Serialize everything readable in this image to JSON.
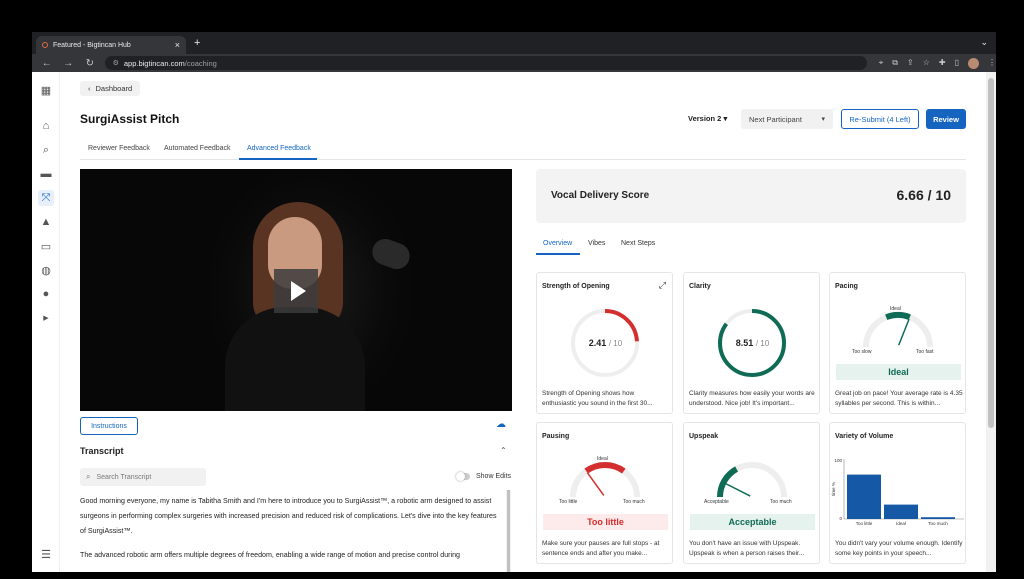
{
  "browser": {
    "tab_title": "Featured - Bigtincan Hub",
    "new_tab": "+",
    "url_host": "app.bigtincan.com",
    "url_path": "/coaching"
  },
  "rail": {
    "icons": [
      "apps-icon",
      "home-icon",
      "search-icon",
      "folder-icon",
      "coaching-icon",
      "graduation-icon",
      "presentation-icon",
      "globe-icon",
      "user-icon",
      "expand-icon"
    ],
    "active_index": 4,
    "bottom_icon": "sliders-icon"
  },
  "header": {
    "breadcrumb": "Dashboard",
    "title": "SurgiAssist Pitch",
    "version": "Version 2",
    "next_participant": "Next Participant",
    "resubmit": "Re-Submit (4 Left)",
    "review": "Review"
  },
  "tabs": [
    "Reviewer Feedback",
    "Automated Feedback",
    "Advanced Feedback"
  ],
  "active_tab": 2,
  "left": {
    "instructions": "Instructions",
    "transcript_title": "Transcript",
    "search_placeholder": "Search Transcript",
    "show_edits": "Show Edits",
    "transcript": [
      "Good morning everyone, my name is Tabitha Smith and I'm here to introduce you to SurgiAssist™, a robotic arm designed to assist surgeons in performing complex surgeries with increased precision and reduced risk of complications. Let's dive into the key features of SurgiAssist™.",
      "The advanced robotic arm offers multiple degrees of freedom, enabling a wide range of motion and precise control during"
    ]
  },
  "score": {
    "label": "Vocal Delivery Score",
    "value": "6.66 / 10"
  },
  "subtabs": [
    "Overview",
    "Vibes",
    "Next Steps"
  ],
  "cards": {
    "strength": {
      "title": "Strength of Opening",
      "value": "2.41",
      "denom": "/ 10",
      "score": 2.41,
      "color": "#d32f2f",
      "desc": "Strength of Opening shows how enthusiastic you sound in the first 30..."
    },
    "clarity": {
      "title": "Clarity",
      "value": "8.51",
      "denom": "/ 10",
      "score": 8.51,
      "color": "#0f6b55",
      "desc": "Clarity measures how easily your words are understood. Nice job! It's important..."
    },
    "pacing": {
      "title": "Pacing",
      "ideal": "Ideal",
      "low": "Too slow",
      "high": "Too fast",
      "tag": "Ideal",
      "level": 0.62,
      "color": "#0f6b55",
      "desc": "Great job on pace! Your average rate is 4.35 syllables per second. This is within..."
    },
    "pausing": {
      "title": "Pausing",
      "ideal": "Ideal",
      "low": "Too little",
      "high": "Too much",
      "tag": "Too little",
      "level": 0.3,
      "color": "#d32f2f",
      "desc": "Make sure your pauses are full stops - at sentence ends and after you make..."
    },
    "upspeak": {
      "title": "Upspeak",
      "low": "Acceptable",
      "high": "Too much",
      "tag": "Acceptable",
      "level": 0.15,
      "color": "#0f6b55",
      "desc": "You don't have an issue with Upspeak. Upspeak is when a person raises their..."
    },
    "volume": {
      "title": "Variety of Volume",
      "ylabel": "time %",
      "ymax": "100",
      "ymin": "0",
      "desc": "You didn't vary your volume enough. Identify some key points in your speech..."
    }
  },
  "chart_data": {
    "type": "bar",
    "categories": [
      "Too little",
      "Ideal",
      "Too much"
    ],
    "values": [
      74,
      24,
      3
    ],
    "ylabel": "time %",
    "ylim": [
      0,
      100
    ]
  },
  "colors": {
    "accent": "#1565c0",
    "good": "#0f6b55",
    "bad": "#d32f2f",
    "good_bg": "#e6f2ee",
    "bad_bg": "#fdeaea"
  }
}
